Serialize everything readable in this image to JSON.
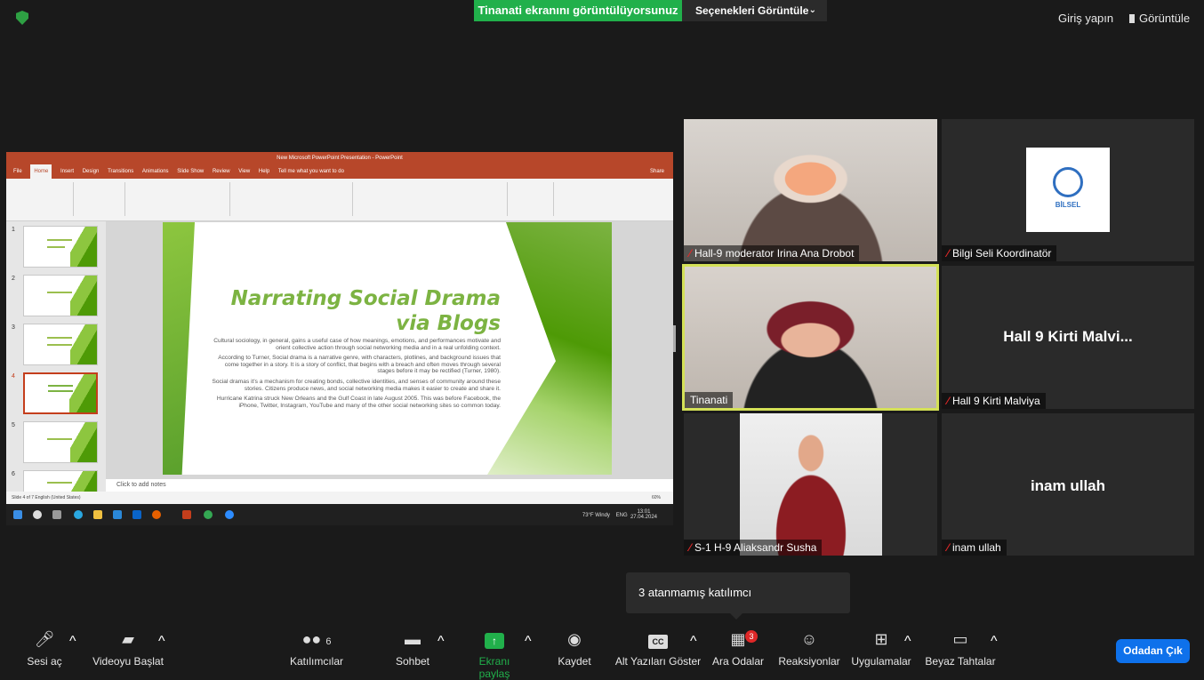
{
  "top": {
    "share_banner": "Tinanati ekranını görüntülüyorsunuz",
    "view_options": "Seçenekleri Görüntüle",
    "sign_in": "Giriş yapın",
    "view": "Görüntüle"
  },
  "shared_screen": {
    "window_title": "New Microsoft PowerPoint Presentation - PowerPoint",
    "tabs": [
      "File",
      "Home",
      "Insert",
      "Design",
      "Transitions",
      "Animations",
      "Slide Show",
      "Review",
      "View",
      "Help",
      "Tell me what you want to do"
    ],
    "share": "Share",
    "slide_numbers": [
      "1",
      "2",
      "3",
      "4",
      "5",
      "6"
    ],
    "slide_title_line1": "Narrating Social Drama",
    "slide_title_line2": "via Blogs",
    "paragraphs": [
      "Cultural sociology, in general, gains a useful case of how meanings, emotions, and performances motivate and orient collective action through social networking media and in a real unfolding context.",
      "According to Turner, Social drama is a narrative genre, with characters, plotlines, and background issues that come together in a story. It is a story of conflict, that begins with a breach and often moves through several stages before it may be rectified (Turner, 1980).",
      "Social dramas it's a mechanism for creating bonds, collective identities, and senses of community around these stories. Citizens produce news, and social networking media makes it easier to create and share it.",
      "Hurricane Katrina struck New Orleans and the Gulf Coast in late August 2005. This was before Facebook, the iPhone, Twitter, Instagram, YouTube and many of the other social networking sites so common today."
    ],
    "notes_placeholder": "Click to add notes",
    "status": "Slide 4 of 7   English (United States)",
    "zoom": "60%",
    "weather": "73°F Windy",
    "lang": "ENG",
    "clock_time": "13:01",
    "clock_date": "27.04.2024"
  },
  "participants": [
    {
      "name": "Hall-9 moderator Irina Ana Drobot",
      "muted": true
    },
    {
      "name": "Bilgi Seli Koordinatör",
      "muted": true,
      "logo": "BİLSEL"
    },
    {
      "name": "Tinanati",
      "muted": false,
      "active_speaker": true
    },
    {
      "name": "Hall 9 Kirti Malviya",
      "muted": true,
      "display_text": "Hall 9 Kirti Malvi..."
    },
    {
      "name": "S-1 H-9 Aliaksandr Susha",
      "muted": true
    },
    {
      "name": "inam ullah",
      "muted": true,
      "display_text": "inam ullah"
    }
  ],
  "tooltip": "3 atanmamış katılımcı",
  "toolbar": {
    "mute": "Sesi aç",
    "video": "Videoyu Başlat",
    "participants": "Katılımcılar",
    "participant_count": "6",
    "chat": "Sohbet",
    "share": "Ekranı paylaş",
    "record": "Kaydet",
    "captions": "Alt Yazıları Göster",
    "breakout": "Ara Odalar",
    "breakout_badge": "3",
    "reactions": "Reaksiyonlar",
    "apps": "Uygulamalar",
    "whiteboards": "Beyaz Tahtalar",
    "leave": "Odadan Çık"
  },
  "colors": {
    "share_green": "#21b04b",
    "leave_blue": "#0e71eb",
    "active_speaker_border": "#d4e157",
    "ppt_red": "#b7472a",
    "slide_green": "#7cb342"
  }
}
